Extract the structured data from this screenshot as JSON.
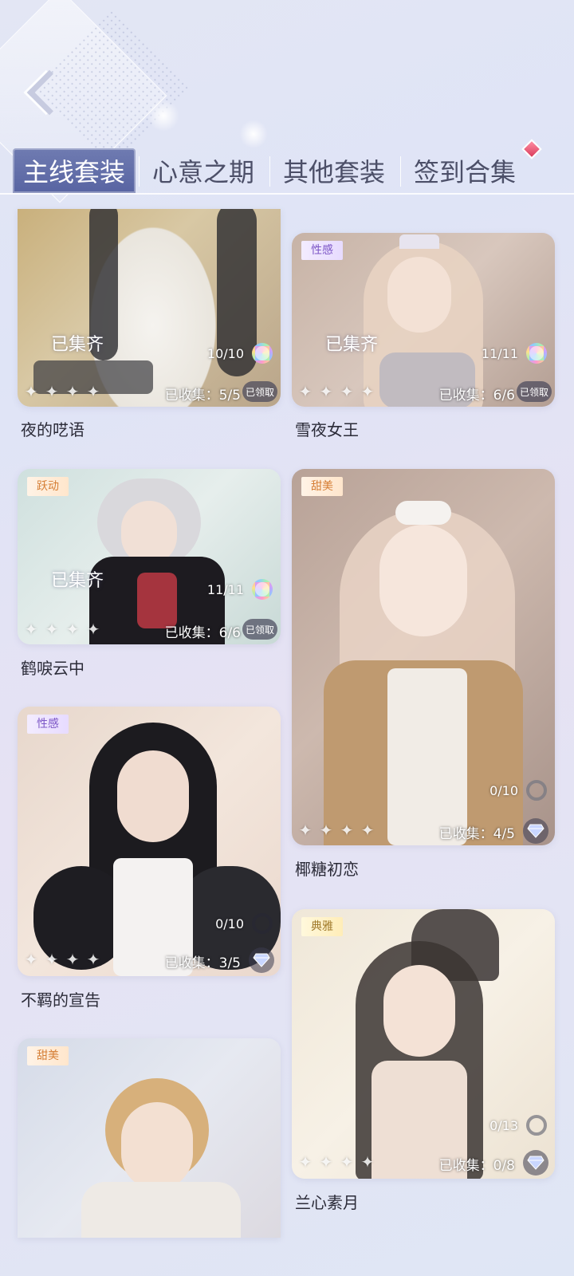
{
  "nav": {
    "back_icon": "chevron-left-icon"
  },
  "tabs": [
    {
      "label": "主线套装",
      "active": true
    },
    {
      "label": "心意之期",
      "active": false
    },
    {
      "label": "其他套装",
      "active": false
    },
    {
      "label": "签到合集",
      "active": false
    }
  ],
  "cards": [
    {
      "title": "夜的呓语",
      "tag": "",
      "complete": "已集齐",
      "progress": "10/10",
      "collected": "已收集：5/5",
      "claim": "已领取",
      "stars": 4
    },
    {
      "title": "雪夜女王",
      "tag": "性感",
      "complete": "已集齐",
      "progress": "11/11",
      "collected": "已收集：6/6",
      "claim": "已领取",
      "stars": 4
    },
    {
      "title": "鹤唳云中",
      "tag": "跃动",
      "complete": "已集齐",
      "progress": "11/11",
      "collected": "已收集：6/6",
      "claim": "已领取",
      "stars": 4
    },
    {
      "title": "椰糖初恋",
      "tag": "甜美",
      "complete": "",
      "progress": "0/10",
      "collected": "已收集：4/5",
      "claim": "",
      "stars": 4
    },
    {
      "title": "不羁的宣告",
      "tag": "性感",
      "complete": "",
      "progress": "0/10",
      "collected": "已收集：3/5",
      "claim": "",
      "stars": 4
    },
    {
      "title": "兰心素月",
      "tag": "典雅",
      "complete": "",
      "progress": "0/13",
      "collected": "已收集：0/8",
      "claim": "",
      "stars": 4
    },
    {
      "title": "",
      "tag": "甜美",
      "complete": "",
      "progress": "",
      "collected": "",
      "claim": "",
      "stars": 0
    }
  ],
  "colors": {
    "tab_active": "#5e6aa6",
    "accent_purple": "#7c56c6"
  }
}
